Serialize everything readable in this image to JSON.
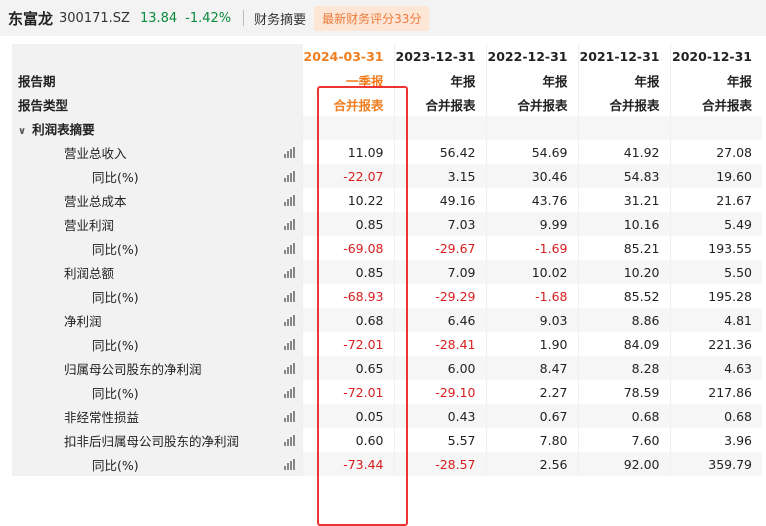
{
  "header": {
    "name": "东富龙",
    "code": "300171.SZ",
    "price": "13.84",
    "change": "-1.42%",
    "summary": "财务摘要",
    "score": "最新财务评分33分"
  },
  "columns": [
    {
      "date": "2024-03-31",
      "period": "一季报",
      "type": "合并报表"
    },
    {
      "date": "2023-12-31",
      "period": "年报",
      "type": "合并报表"
    },
    {
      "date": "2022-12-31",
      "period": "年报",
      "type": "合并报表"
    },
    {
      "date": "2021-12-31",
      "period": "年报",
      "type": "合并报表"
    },
    {
      "date": "2020-12-31",
      "period": "年报",
      "type": "合并报表"
    }
  ],
  "row_labels": {
    "period": "报告期",
    "type": "报告类型",
    "section": "利润表摘要"
  },
  "rows": [
    {
      "label": "营业总收入",
      "values": [
        "11.09",
        "56.42",
        "54.69",
        "41.92",
        "27.08"
      ]
    },
    {
      "label": "同比(%)",
      "values": [
        "-22.07",
        "3.15",
        "30.46",
        "54.83",
        "19.60"
      ]
    },
    {
      "label": "营业总成本",
      "values": [
        "10.22",
        "49.16",
        "43.76",
        "31.21",
        "21.67"
      ]
    },
    {
      "label": "营业利润",
      "values": [
        "0.85",
        "7.03",
        "9.99",
        "10.16",
        "5.49"
      ]
    },
    {
      "label": "同比(%)",
      "values": [
        "-69.08",
        "-29.67",
        "-1.69",
        "85.21",
        "193.55"
      ]
    },
    {
      "label": "利润总额",
      "values": [
        "0.85",
        "7.09",
        "10.02",
        "10.20",
        "5.50"
      ]
    },
    {
      "label": "同比(%)",
      "values": [
        "-68.93",
        "-29.29",
        "-1.68",
        "85.52",
        "195.28"
      ]
    },
    {
      "label": "净利润",
      "values": [
        "0.68",
        "6.46",
        "9.03",
        "8.86",
        "4.81"
      ]
    },
    {
      "label": "同比(%)",
      "values": [
        "-72.01",
        "-28.41",
        "1.90",
        "84.09",
        "221.36"
      ]
    },
    {
      "label": "归属母公司股东的净利润",
      "values": [
        "0.65",
        "6.00",
        "8.47",
        "8.28",
        "4.63"
      ]
    },
    {
      "label": "同比(%)",
      "values": [
        "-72.01",
        "-29.10",
        "2.27",
        "78.59",
        "217.86"
      ]
    },
    {
      "label": "非经常性损益",
      "values": [
        "0.05",
        "0.43",
        "0.67",
        "0.68",
        "0.68"
      ]
    },
    {
      "label": "扣非后归属母公司股东的净利润",
      "values": [
        "0.60",
        "5.57",
        "7.80",
        "7.60",
        "3.96"
      ]
    },
    {
      "label": "同比(%)",
      "values": [
        "-73.44",
        "-28.57",
        "2.56",
        "92.00",
        "359.79"
      ]
    }
  ]
}
